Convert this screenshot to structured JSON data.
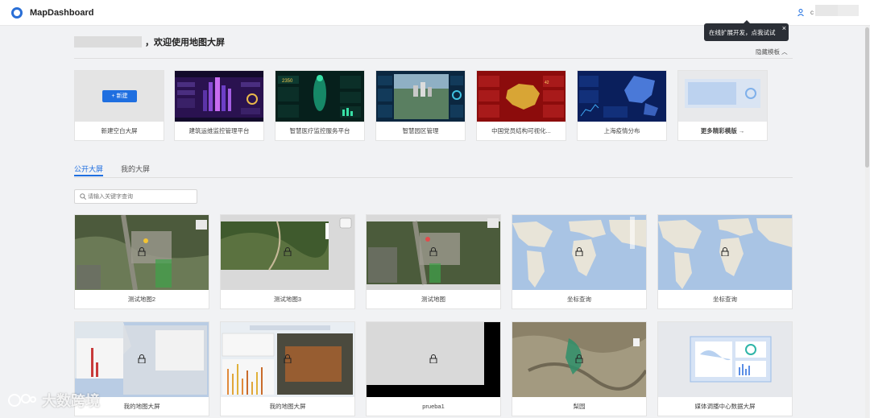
{
  "header": {
    "app_title": "MapDashboard",
    "user_initial": "c"
  },
  "tooltip": {
    "text": "在线扩展开发，点我试试",
    "close": "×"
  },
  "welcome": {
    "text": "，欢迎使用地图大屏"
  },
  "templates_toggle": "隐藏模板 ︿",
  "templates": [
    {
      "label": "新建空白大屏",
      "button": "+ 新建"
    },
    {
      "label": "建筑运维监控管理平台"
    },
    {
      "label": "智慧医疗监控服务平台"
    },
    {
      "label": "智慧园区管理"
    },
    {
      "label": "中国党员结构可视化..."
    },
    {
      "label": "上海疫情分布"
    },
    {
      "label": "更多精彩模版 →"
    }
  ],
  "tabs": [
    {
      "label": "公开大屏"
    },
    {
      "label": "我的大屏"
    }
  ],
  "search": {
    "placeholder": "请输入关键字查询"
  },
  "cards": [
    {
      "label": "测试地图2"
    },
    {
      "label": "测试地图3"
    },
    {
      "label": "测试地图"
    },
    {
      "label": "坐标查询"
    },
    {
      "label": "坐标查询"
    },
    {
      "label": "我的地图大屏"
    },
    {
      "label": "我的地图大屏"
    },
    {
      "label": "prueba1"
    },
    {
      "label": "梨园"
    },
    {
      "label": "媒体调播中心数据大屏"
    }
  ],
  "watermark": {
    "text": "大数跨境"
  },
  "colors": {
    "accent": "#1f6fe0",
    "tooltip_bg": "#2b2f36",
    "page_bg": "#f1f2f4"
  }
}
